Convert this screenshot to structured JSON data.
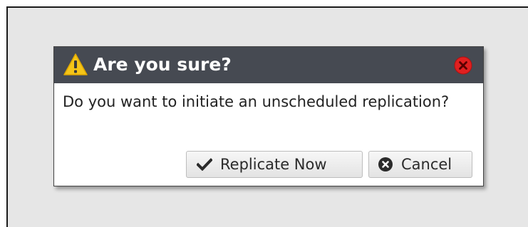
{
  "dialog": {
    "title": "Are you sure?",
    "message": "Do you want to initiate an unscheduled replication?",
    "buttons": {
      "replicate_label": "Replicate Now",
      "cancel_label": "Cancel"
    }
  },
  "icons": {
    "title": "warning-icon",
    "close": "close-icon",
    "replicate": "checkmark-icon",
    "cancel": "cancel-circle-icon"
  },
  "colors": {
    "titlebar_bg": "#464a52",
    "warning": "#f5c518",
    "close": "#e02020",
    "background": "#e6e6e6"
  }
}
